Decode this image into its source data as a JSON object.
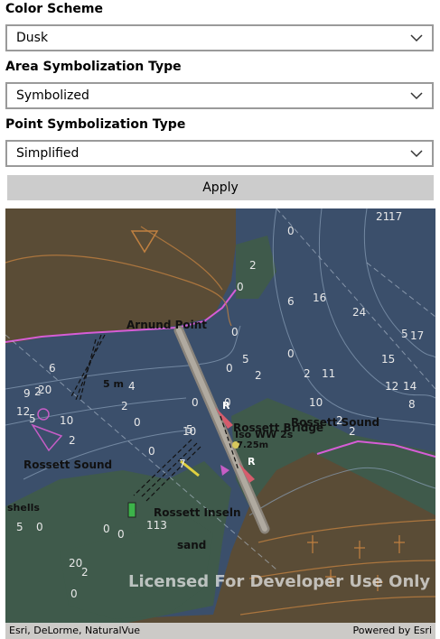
{
  "color_scheme": {
    "label": "Color Scheme",
    "value": "Dusk"
  },
  "area_symbolization": {
    "label": "Area Symbolization Type",
    "value": "Symbolized"
  },
  "point_symbolization": {
    "label": "Point Symbolization Type",
    "value": "Simplified"
  },
  "apply_button": {
    "label": "Apply"
  },
  "map": {
    "place_labels": [
      "Arnund Point",
      "Rossett Sound",
      "Rossett Sound",
      "Rossett Bridge",
      "Rossett Inseln",
      "sand",
      "shells",
      "5 m",
      "R",
      "R",
      "Iso WW 2s",
      "7.25m"
    ],
    "soundings": [
      "0",
      "2",
      "0",
      "6",
      "16",
      "24",
      "21",
      "17",
      "5",
      "0",
      "0",
      "5",
      "2",
      "0",
      "2",
      "17",
      "11",
      "10",
      "0",
      "0",
      "2",
      "2",
      "5",
      "10",
      "12",
      "9",
      "6",
      "10",
      "2",
      "5",
      "2",
      "0",
      "0",
      "5",
      "0",
      "20",
      "2",
      "0",
      "113",
      "0",
      "7",
      "14",
      "8",
      "15",
      "12",
      "20",
      "4",
      "2",
      "0"
    ],
    "watermark": "Licensed For Developer Use Only",
    "attribution": "Esri, DeLorme, NaturalVue",
    "powered_by": "Powered by Esri"
  },
  "colors": {
    "land": "#5a4c36",
    "water": "#3b4f6b",
    "shallow": "#3f5a4b",
    "bridge": "#b0aaa0",
    "coast": "#d65dd6"
  }
}
